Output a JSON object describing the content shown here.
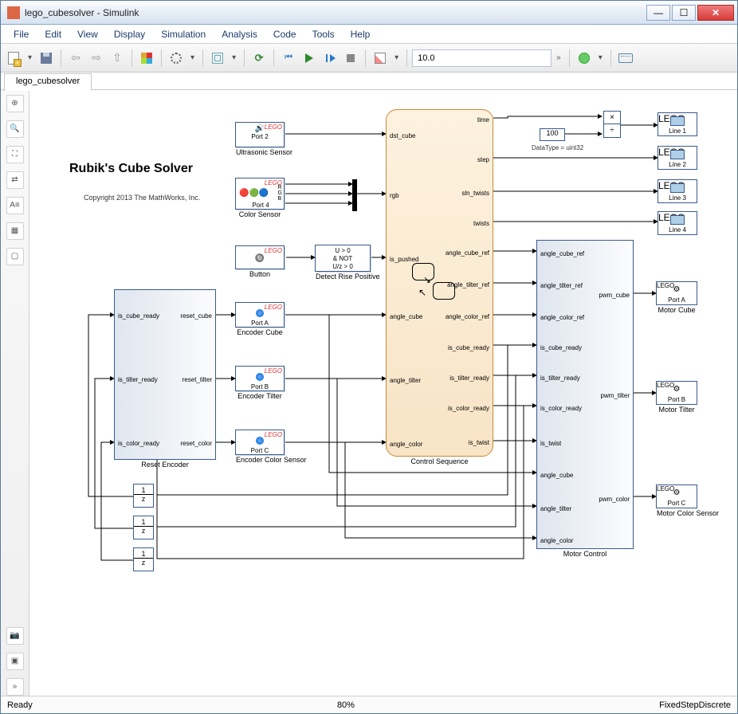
{
  "title": "lego_cubesolver - Simulink",
  "menu": [
    "File",
    "Edit",
    "View",
    "Display",
    "Simulation",
    "Analysis",
    "Code",
    "Tools",
    "Help"
  ],
  "tab": "lego_cubesolver",
  "time": "10.0",
  "status": {
    "left": "Ready",
    "mid": "80%",
    "right": "FixedStepDiscrete"
  },
  "canvas": {
    "title": "Rubik's Cube Solver",
    "copyright": "Copyright 2013 The MathWorks, Inc."
  },
  "blocks": {
    "ultrasonic": {
      "label": "Ultrasonic Sensor",
      "text": "Port 2"
    },
    "color": {
      "label": "Color Sensor",
      "text": "Port 4",
      "ch": [
        "R",
        "G",
        "B"
      ]
    },
    "button": {
      "label": "Button"
    },
    "detect": {
      "label": "Detect Rise Positive",
      "l1": "U > 0",
      "l2": "& NOT",
      "l3": "U/z > 0"
    },
    "encA": {
      "label": "Encoder Cube",
      "text": "Port A"
    },
    "encB": {
      "label": "Encoder Tilter",
      "text": "Port B"
    },
    "encC": {
      "label": "Encoder Color Sensor",
      "text": "Port C"
    },
    "reset": {
      "label": "Reset Encoder",
      "left": [
        "is_cube_ready",
        "is_tilter_ready",
        "is_color_ready"
      ],
      "right": [
        "reset_cube",
        "reset_tilter",
        "reset_color"
      ]
    },
    "ctrlseq": {
      "label": "Control Sequence",
      "left": [
        "dst_cube",
        "rgb",
        "is_pushed",
        "angle_cube",
        "angle_tilter",
        "angle_color"
      ],
      "right": [
        "time",
        "step",
        "sln_twists",
        "twists",
        "angle_cube_ref",
        "angle_tilter_ref",
        "angle_color_ref",
        "is_cube_ready",
        "is_tilter_ready",
        "is_color_ready",
        "is_twist"
      ]
    },
    "motor": {
      "label": "Motor Control",
      "left": [
        "angle_cube_ref",
        "angle_tilter_ref",
        "angle_color_ref",
        "is_cube_ready",
        "is_tilter_ready",
        "is_color_ready",
        "is_twist",
        "angle_cube",
        "angle_tilter",
        "angle_color"
      ],
      "right": [
        "pwm_cube",
        "pwm_tilter",
        "pwm_color"
      ]
    },
    "const100": "100",
    "datatype": "DataType = uint32",
    "motA": {
      "label": "Motor Cube",
      "text": "Port A"
    },
    "motB": {
      "label": "Motor Tilter",
      "text": "Port B"
    },
    "motC": {
      "label": "Motor Color Sensor",
      "text": "Port C"
    },
    "lines": [
      "Line 1",
      "Line 2",
      "Line 3",
      "Line 4"
    ],
    "lego": "LEGO",
    "delay": {
      "num": "1",
      "den": "z"
    },
    "prod": [
      "×",
      "÷"
    ]
  }
}
